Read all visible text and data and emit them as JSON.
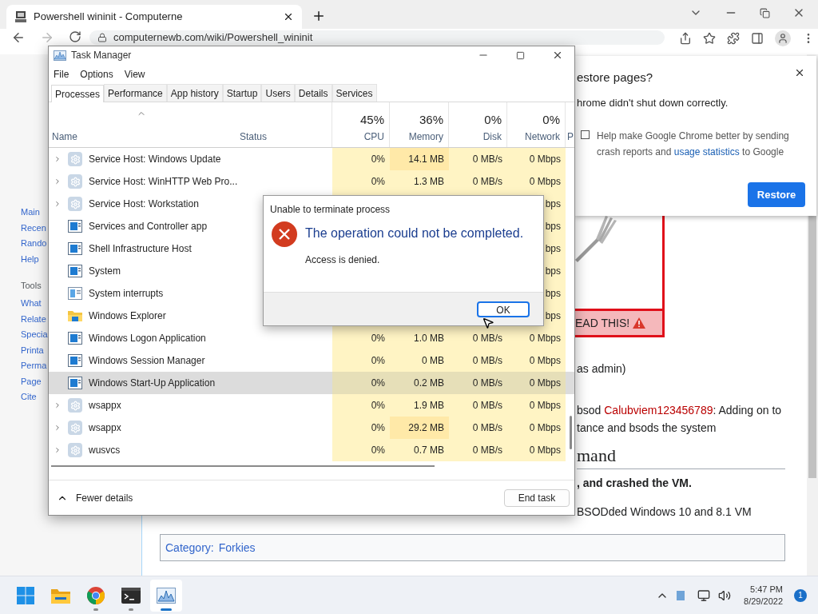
{
  "browser": {
    "tab_title": "Powershell wininit - Computerne",
    "address": "computernewb.com/wiki/Powershell_wininit"
  },
  "wiki": {
    "nav_links": [
      "Main",
      "Recen",
      "Rando",
      "Help"
    ],
    "tools_heading": "Tools",
    "tools_links": [
      "What",
      "Relate",
      "Specia",
      "Printa",
      "Perma",
      "Page",
      "Cite"
    ],
    "notice": "EAD THIS!",
    "lines": [
      {
        "kind": "plain",
        "text": "as admin)"
      },
      {
        "kind": "link",
        "before": "bsod ",
        "link": "Calubviem123456789",
        "after": ": Adding on to"
      },
      {
        "kind": "plain",
        "text": "tance and bsods the system"
      },
      {
        "kind": "heading",
        "text": "mand"
      },
      {
        "kind": "bold",
        "text": ", and crashed the VM."
      },
      {
        "kind": "plain",
        "text": "BSODded Windows 10 and 8.1 VM"
      }
    ],
    "category": {
      "label": "Category:",
      "value": "Forkies"
    }
  },
  "restore_popup": {
    "title": "estore pages?",
    "message": "hrome didn't shut down correctly.",
    "checked": false,
    "before": "Help make Google Chrome better by sending crash reports and ",
    "link": "usage statistics",
    "after": " to Google",
    "button": "Restore"
  },
  "task_manager": {
    "title": "Task Manager",
    "menu": [
      "File",
      "Options",
      "View"
    ],
    "tabs": [
      {
        "label": "Processes",
        "selected": true
      },
      {
        "label": "Performance",
        "selected": false
      },
      {
        "label": "App history",
        "selected": false
      },
      {
        "label": "Startup",
        "selected": false
      },
      {
        "label": "Users",
        "selected": false
      },
      {
        "label": "Details",
        "selected": false
      },
      {
        "label": "Services",
        "selected": false
      }
    ],
    "columns": [
      {
        "label": "Name"
      },
      {
        "label": "Status"
      },
      {
        "percent": "45%",
        "label": "CPU"
      },
      {
        "percent": "36%",
        "label": "Memory"
      },
      {
        "percent": "0%",
        "label": "Disk"
      },
      {
        "percent": "0%",
        "label": "Network"
      },
      {
        "label": "P"
      }
    ],
    "rows": [
      {
        "kind": "gear",
        "name": "Service Host: Windows Update",
        "expandable": true,
        "selected": false,
        "cpu": "0%",
        "memory": "14.1 MB",
        "disk": "0 MB/s",
        "network": "0 Mbps"
      },
      {
        "kind": "gear",
        "name": "Service Host: WinHTTP Web Pro...",
        "expandable": true,
        "selected": false,
        "cpu": "0%",
        "memory": "1.3 MB",
        "disk": "0 MB/s",
        "network": "0 Mbps"
      },
      {
        "kind": "gear",
        "name": "Service Host: Workstation",
        "expandable": true,
        "selected": false,
        "network": "bps"
      },
      {
        "kind": "window",
        "name": "Services and Controller app",
        "expandable": false,
        "selected": false,
        "network": "bps"
      },
      {
        "kind": "window",
        "name": "Shell Infrastructure Host",
        "expandable": false,
        "selected": false,
        "network": "bps"
      },
      {
        "kind": "window",
        "name": "System",
        "expandable": false,
        "selected": false,
        "network": "bps"
      },
      {
        "kind": "interrupts",
        "name": "System interrupts",
        "expandable": false,
        "selected": false,
        "network": "bps"
      },
      {
        "kind": "folder",
        "name": "Windows Explorer",
        "expandable": false,
        "selected": false,
        "network": "bps"
      },
      {
        "kind": "window",
        "name": "Windows Logon Application",
        "expandable": false,
        "selected": false,
        "cpu": "0%",
        "memory": "1.0 MB",
        "disk": "0 MB/s",
        "network": "0 Mbps"
      },
      {
        "kind": "window",
        "name": "Windows Session Manager",
        "expandable": false,
        "selected": false,
        "cpu": "0%",
        "memory": "0 MB",
        "disk": "0 MB/s",
        "network": "0 Mbps"
      },
      {
        "kind": "window",
        "name": "Windows Start-Up Application",
        "expandable": false,
        "selected": true,
        "cpu": "0%",
        "memory": "0.2 MB",
        "disk": "0 MB/s",
        "network": "0 Mbps"
      },
      {
        "kind": "gear",
        "name": "wsappx",
        "expandable": true,
        "selected": false,
        "cpu": "0%",
        "memory": "1.9 MB",
        "disk": "0 MB/s",
        "network": "0 Mbps"
      },
      {
        "kind": "gear",
        "name": "wsappx",
        "expandable": true,
        "selected": false,
        "cpu": "0%",
        "memory": "29.2 MB",
        "disk": "0 MB/s",
        "network": "0 Mbps"
      },
      {
        "kind": "gear",
        "name": "wusvcs",
        "expandable": true,
        "selected": false,
        "cpu": "0%",
        "memory": "0.7 MB",
        "disk": "0 MB/s",
        "network": "0 Mbps"
      }
    ],
    "fewer_details": "Fewer details",
    "end_task": "End task"
  },
  "dialog": {
    "title": "Unable to terminate process",
    "heading": "The operation could not be completed.",
    "message": "Access is denied.",
    "button": "OK"
  },
  "taskbar": {
    "apps": [
      {
        "kind": "start",
        "running": false,
        "selected": false
      },
      {
        "kind": "explorer",
        "running": false,
        "selected": false
      },
      {
        "kind": "browser",
        "running": true,
        "selected": false
      },
      {
        "kind": "terminal",
        "running": true,
        "selected": false
      },
      {
        "kind": "taskmanager",
        "running": true,
        "selected": true
      }
    ],
    "time": "5:47 PM",
    "date": "8/29/2022",
    "badge": "1"
  }
}
